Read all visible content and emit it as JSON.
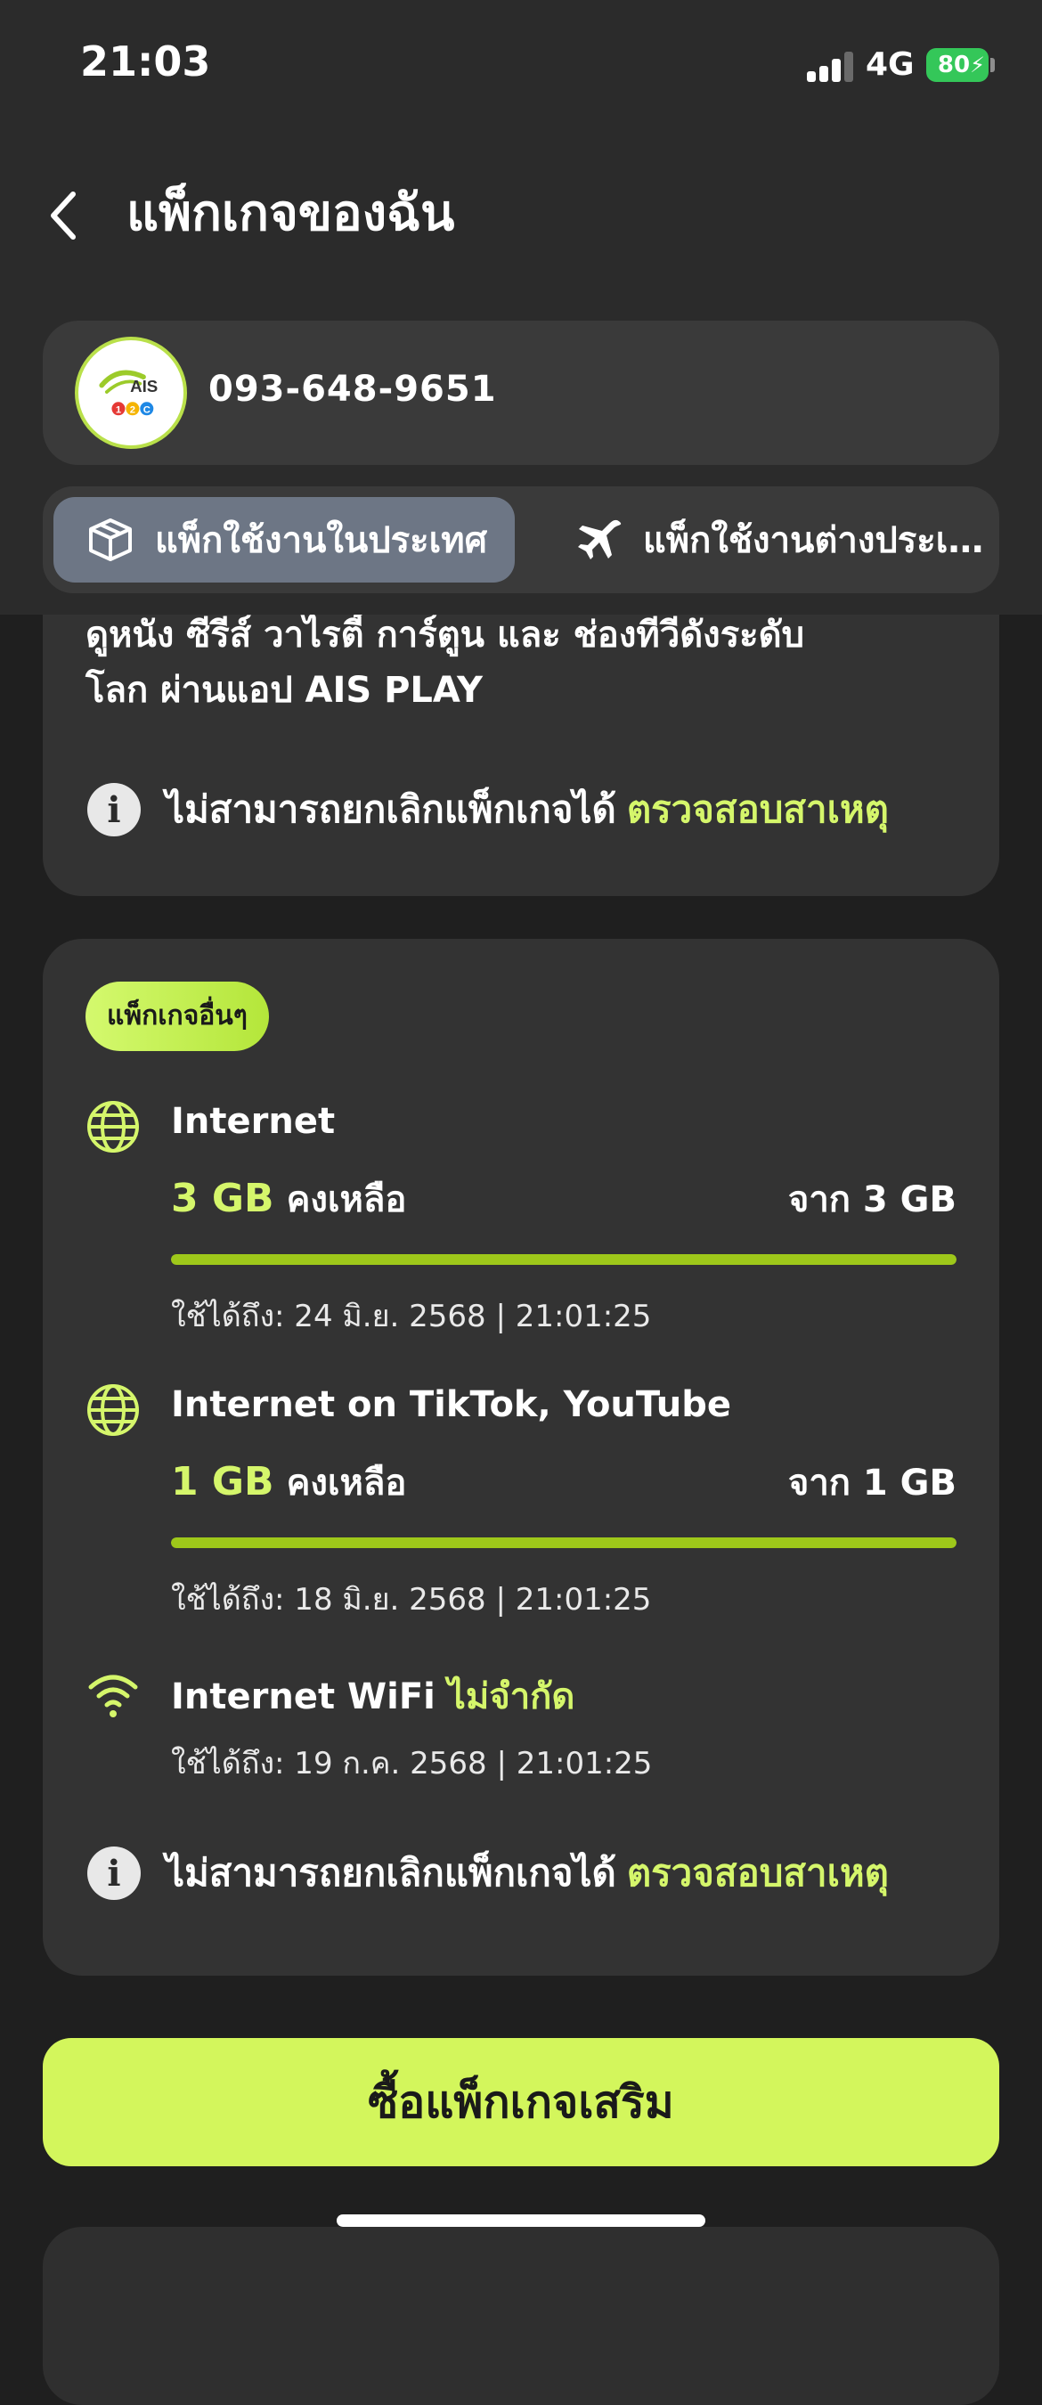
{
  "status_bar": {
    "time": "21:03",
    "network": "4G",
    "battery": "80",
    "battery_level_percent": 80
  },
  "header": {
    "title": "แพ็กเกจของฉัน",
    "back_icon": "chevron-left-icon"
  },
  "account": {
    "phone_number": "093-648-9651",
    "logo_text": "AIS",
    "logo_sub": [
      "1",
      "2",
      "C"
    ]
  },
  "tabs": [
    {
      "label": "แพ็กใช้งานในประเทศ",
      "icon": "package-box-icon",
      "active": true
    },
    {
      "label": "แพ็กใช้งานต่างประเทศ",
      "icon": "airplane-icon",
      "active": false
    }
  ],
  "top_card": {
    "partial_line": "ดูหนัง ซีรีส์ วาไรตี้ การ์ตูน และ ช่องทีวีดังระดับ",
    "description": "โลก ผ่านแอป AIS PLAY",
    "notice": "ไม่สามารถยกเลิกแพ็กเกจได้",
    "notice_link": "ตรวจสอบสาเหตุ"
  },
  "pack_card": {
    "badge": "แพ็กเกจอื่นๆ",
    "items": [
      {
        "icon": "globe-icon",
        "name": "Internet",
        "remaining": "3 GB",
        "remaining_suffix": "คงเหลือ",
        "total": "จาก 3 GB",
        "progress_fraction": 1.0,
        "expiry": "ใช้ได้ถึง: 24 มิ.ย. 2568 | 21:01:25"
      },
      {
        "icon": "globe-icon",
        "name": "Internet on TikTok, YouTube",
        "remaining": "1 GB",
        "remaining_suffix": "คงเหลือ",
        "total": "จาก 1 GB",
        "progress_fraction": 1.0,
        "expiry": "ใช้ได้ถึง: 18 มิ.ย. 2568 | 21:01:25"
      },
      {
        "icon": "wifi-icon",
        "name": "Internet WiFi",
        "name_highlight": "ไม่จำกัด",
        "expiry": "ใช้ได้ถึง: 19 ก.ค. 2568 | 21:01:25"
      }
    ],
    "notice": "ไม่สามารถยกเลิกแพ็กเกจได้",
    "notice_link": "ตรวจสอบสาเหตุ"
  },
  "buy_button": "ซื้อแพ็กเกจเสริม",
  "colors": {
    "accent": "#d5f66b",
    "progress": "#9ec81a",
    "background": "#1f1f1f",
    "card": "#333333",
    "header": "#2b2b2b",
    "active_tab": "#6d7685"
  }
}
